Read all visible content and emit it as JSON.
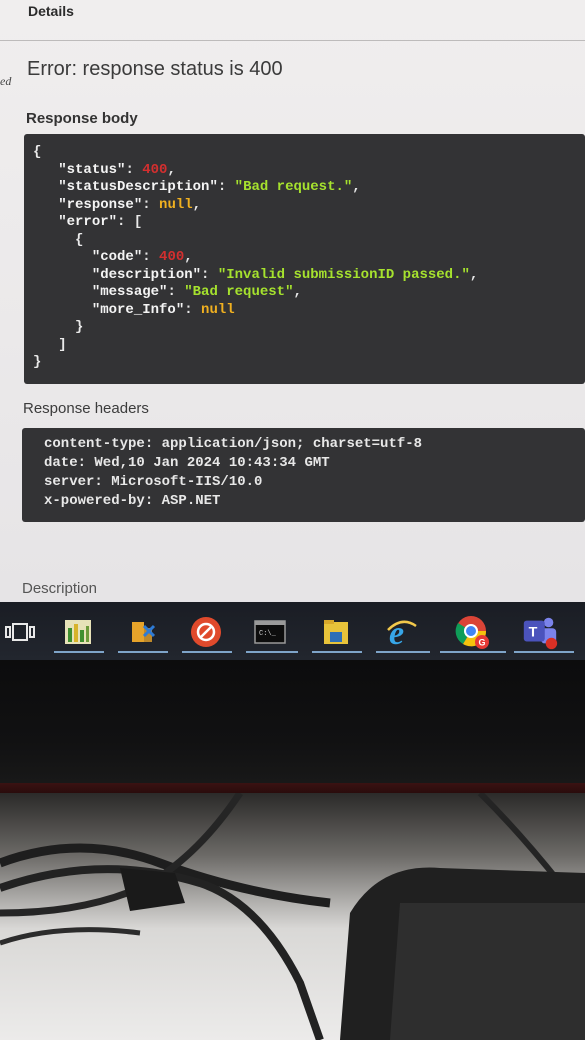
{
  "page": {
    "details_tab": "Details",
    "edge_fragment": "ed",
    "error_title": "Error: response status is 400",
    "response_body_label": "Response body",
    "response_headers_label": "Response headers",
    "description_label": "Description"
  },
  "response_body": {
    "open_brace": "{",
    "status_key": "\"status\"",
    "status_value": "400",
    "status_description_key": "\"statusDescription\"",
    "status_description_value": "\"Bad request.\"",
    "response_key": "\"response\"",
    "response_value": "null",
    "error_key": "\"error\"",
    "error_open": "[",
    "item_open": "{",
    "code_key": "\"code\"",
    "code_value": "400",
    "description_key": "\"description\"",
    "description_value": "\"Invalid submissionID passed.\"",
    "message_key": "\"message\"",
    "message_value": "\"Bad request\"",
    "more_info_key": "\"more_Info\"",
    "more_info_value": "null",
    "item_close": "}",
    "error_close": "]",
    "close_brace": "}"
  },
  "response_headers": [
    "content-type: application/json; charset=utf-8",
    "date: Wed,10 Jan 2024 10:43:34 GMT",
    "server: Microsoft-IIS/10.0",
    "x-powered-by: ASP.NET"
  ],
  "taskbar": {
    "items": [
      {
        "icon": "task-view-icon"
      },
      {
        "icon": "spreadsheet-app-icon"
      },
      {
        "icon": "tools-app-icon"
      },
      {
        "icon": "red-circle-app-icon"
      },
      {
        "icon": "command-prompt-icon",
        "label": "C:\\_"
      },
      {
        "icon": "file-explorer-icon"
      },
      {
        "icon": "internet-explorer-icon",
        "label": "e"
      },
      {
        "icon": "chrome-icon",
        "label": "G"
      },
      {
        "icon": "teams-icon",
        "label": "T"
      }
    ]
  },
  "colors": {
    "json_string": "#a6e22e",
    "json_number": "#d32f2f",
    "json_null": "#f0b020",
    "code_background": "#333335"
  }
}
